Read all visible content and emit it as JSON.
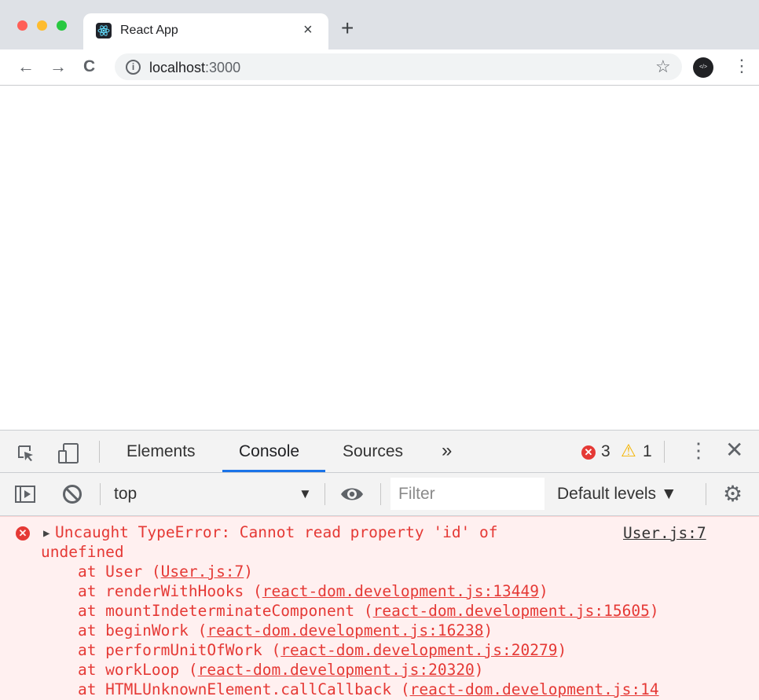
{
  "browser": {
    "tab": {
      "title": "React App",
      "close": "×"
    },
    "new_tab": "+",
    "nav": {
      "back": "←",
      "forward": "→",
      "reload": "C"
    },
    "omnibox": {
      "info": "i",
      "host": "localhost",
      "port": ":3000"
    },
    "profile_label": "</>",
    "colors": {
      "close": "#ff5f57",
      "minimize": "#febc2e",
      "zoom": "#28c840"
    }
  },
  "devtools": {
    "tabs": [
      {
        "label": "Elements"
      },
      {
        "label": "Console",
        "active": true
      },
      {
        "label": "Sources"
      }
    ],
    "more_tabs": "»",
    "error_count": "3",
    "warning_count": "1",
    "console_bar": {
      "context": "top",
      "filter_placeholder": "Filter",
      "levels": "Default levels"
    },
    "message": {
      "line1": "Uncaught TypeError: Cannot read property 'id' of",
      "line2": "undefined",
      "source": "User.js:7",
      "stack": [
        {
          "prefix": "    at User (",
          "link": "User.js:7",
          "suffix": ")"
        },
        {
          "prefix": "    at renderWithHooks (",
          "link": "react-dom.development.js:13449",
          "suffix": ")"
        },
        {
          "prefix": "    at mountIndeterminateComponent (",
          "link": "react-dom.development.js:15605",
          "suffix": ")"
        },
        {
          "prefix": "    at beginWork (",
          "link": "react-dom.development.js:16238",
          "suffix": ")"
        },
        {
          "prefix": "    at performUnitOfWork (",
          "link": "react-dom.development.js:20279",
          "suffix": ")"
        },
        {
          "prefix": "    at workLoop (",
          "link": "react-dom.development.js:20320",
          "suffix": ")"
        },
        {
          "prefix": "    at HTMLUnknownElement.callCallback (",
          "link": "react-dom.development.js:14",
          "suffix": ""
        }
      ]
    }
  }
}
